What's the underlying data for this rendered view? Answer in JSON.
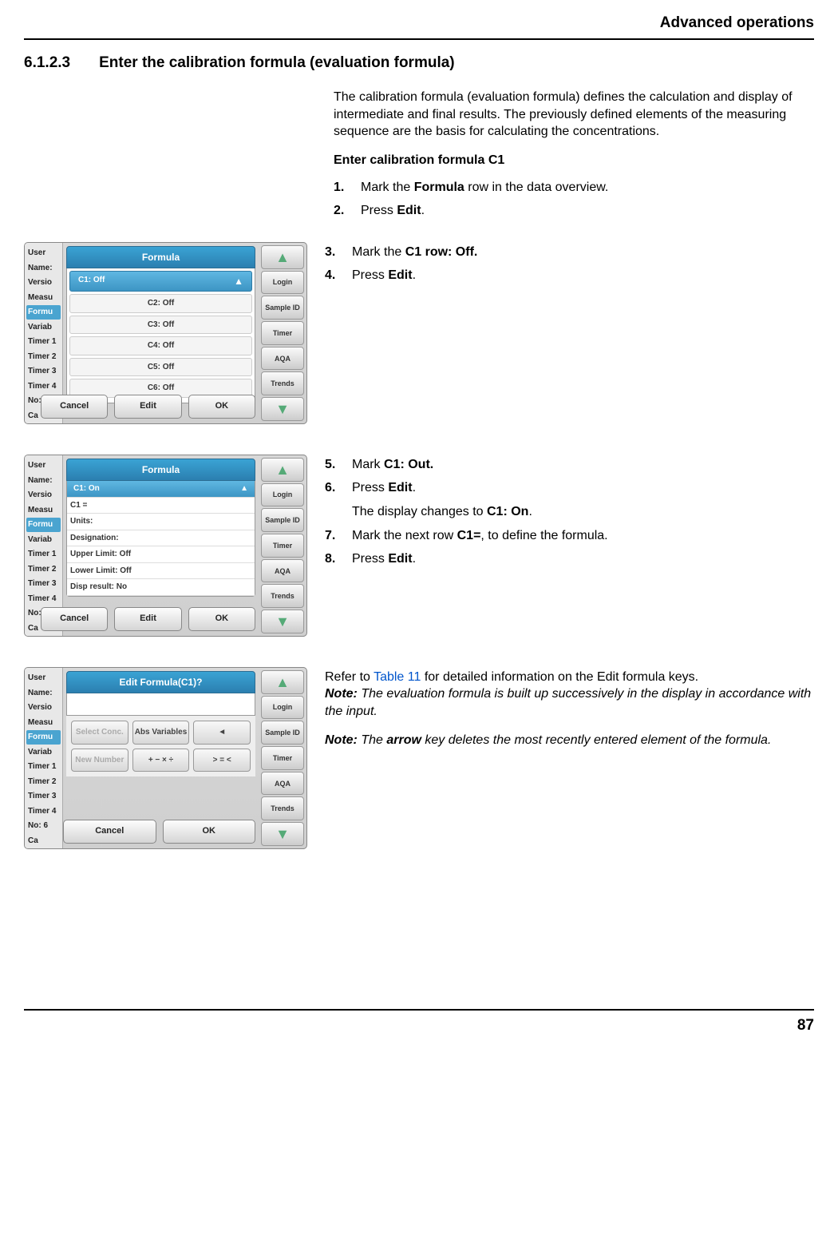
{
  "header": {
    "title": "Advanced operations"
  },
  "section": {
    "number": "6.1.2.3",
    "title": "Enter the calibration formula (evaluation formula)"
  },
  "intro": "The calibration formula (evaluation formula) defines the calculation and display of intermediate and final results. The previously defined elements of the measuring sequence are the basis for calculating the concentrations.",
  "subhead": "Enter calibration formula C1",
  "steps_a": [
    {
      "n": "1.",
      "pre": "Mark the ",
      "b": "Formula",
      "post": " row in the data overview."
    },
    {
      "n": "2.",
      "pre": "Press ",
      "b": "Edit",
      "post": "."
    }
  ],
  "steps_b": [
    {
      "n": "3.",
      "pre": "Mark the ",
      "b": "C1 row: Off.",
      "post": ""
    },
    {
      "n": "4.",
      "pre": "Press ",
      "b": "Edit",
      "post": "."
    }
  ],
  "steps_c": [
    {
      "n": "5.",
      "pre": "Mark ",
      "b": "C1: Out.",
      "post": ""
    },
    {
      "n": "6.",
      "pre": "Press ",
      "b": "Edit",
      "post": "."
    }
  ],
  "c_sub_pre": "The display changes to ",
  "c_sub_b": "C1: On",
  "c_sub_post": ".",
  "steps_c2": [
    {
      "n": "7.",
      "pre": "Mark the next row ",
      "b": "C1=",
      "post": ", to define the formula."
    },
    {
      "n": "8.",
      "pre": "Press ",
      "b": "Edit",
      "post": "."
    }
  ],
  "refer_pre": "Refer to ",
  "refer_link": "Table 11",
  "refer_post": " for detailed information on the Edit formula keys.",
  "note1_label": "Note:",
  "note1": " The evaluation formula is built up successively in the display in accordance with the input.",
  "note2_label": "Note:",
  "note2_pre": " The ",
  "note2_b": "arrow",
  "note2_post": " key deletes the most recently entered element of the formula.",
  "page": "87",
  "shot_common": {
    "leftcol": [
      "User",
      "Name:",
      "Versio",
      "Measu",
      "Formu",
      "Variab",
      "Timer 1",
      "Timer 2",
      "Timer 3",
      "Timer 4",
      "No: 6",
      "Ca"
    ],
    "right_icons": [
      "▲",
      "Login",
      "Sample ID",
      "Timer",
      "AQA",
      "Trends",
      "▼"
    ]
  },
  "shot1": {
    "title": "Formula",
    "rows": [
      "C1: Off",
      "C2: Off",
      "C3: Off",
      "C4: Off",
      "C5: Off",
      "C6: Off"
    ],
    "footer": [
      "Cancel",
      "Edit",
      "OK"
    ]
  },
  "shot2": {
    "title": "Formula",
    "sel": "C1: On",
    "rows": [
      "C1 =",
      "Units:",
      "Designation:",
      "Upper Limit: Off",
      "Lower Limit: Off",
      "Disp result: No"
    ],
    "footer": [
      "Cancel",
      "Edit",
      "OK"
    ]
  },
  "shot3": {
    "title": "Edit Formula(C1)?",
    "keys": [
      "Select Conc.",
      "Abs Variables",
      "◄",
      "New Number",
      "+ − × ÷",
      "> = <"
    ],
    "footer": [
      "Cancel",
      "OK"
    ]
  }
}
